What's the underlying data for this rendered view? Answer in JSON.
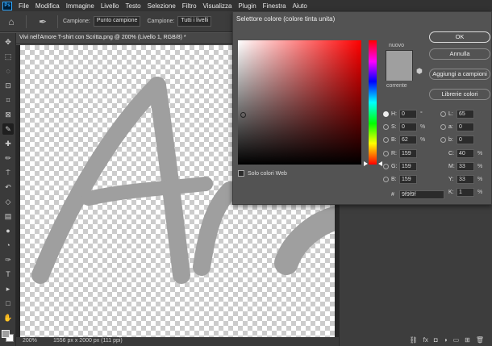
{
  "app": {
    "logo": "Ps"
  },
  "menu": [
    "File",
    "Modifica",
    "Immagine",
    "Livello",
    "Testo",
    "Selezione",
    "Filtro",
    "Visualizza",
    "Plugin",
    "Finestra",
    "Aiuto"
  ],
  "options_bar": {
    "sample_label": "Campione:",
    "sample_value": "Punto campione",
    "sample2_label": "Campione:",
    "sample2_value": "Tutti i livelli"
  },
  "document": {
    "tab_title": "Vivi nell'Amore T-shirt con Scritta.png @ 200% (Livello 1, RGB/8) *",
    "zoom": "200%",
    "info": "1556 px x 2000 px (111 ppi)",
    "fg_color": "#9f9f9f"
  },
  "dialog": {
    "title": "Selettore colore (colore tinta unita)",
    "new_label": "nuovo",
    "current_label": "corrente",
    "web_only_label": "Solo colori Web",
    "buttons": {
      "ok": "OK",
      "cancel": "Annulla",
      "add_swatch": "Aggiungi a campioni",
      "libraries": "Librerie colori"
    },
    "hsb": [
      {
        "label": "H:",
        "value": "0",
        "unit": "°"
      },
      {
        "label": "S:",
        "value": "0",
        "unit": "%"
      },
      {
        "label": "B:",
        "value": "62",
        "unit": "%"
      }
    ],
    "rgb": [
      {
        "label": "R:",
        "value": "159"
      },
      {
        "label": "G:",
        "value": "159"
      },
      {
        "label": "B:",
        "value": "159"
      }
    ],
    "lab": [
      {
        "label": "L:",
        "value": "65"
      },
      {
        "label": "a:",
        "value": "0"
      },
      {
        "label": "b:",
        "value": "0"
      }
    ],
    "cmyk": [
      {
        "label": "C:",
        "value": "40",
        "unit": "%"
      },
      {
        "label": "M:",
        "value": "33",
        "unit": "%"
      },
      {
        "label": "Y:",
        "value": "33",
        "unit": "%"
      },
      {
        "label": "K:",
        "value": "1",
        "unit": "%"
      }
    ],
    "hex_label": "#",
    "hex_value": "9f9f9f",
    "selected_color": "#9f9f9f"
  }
}
